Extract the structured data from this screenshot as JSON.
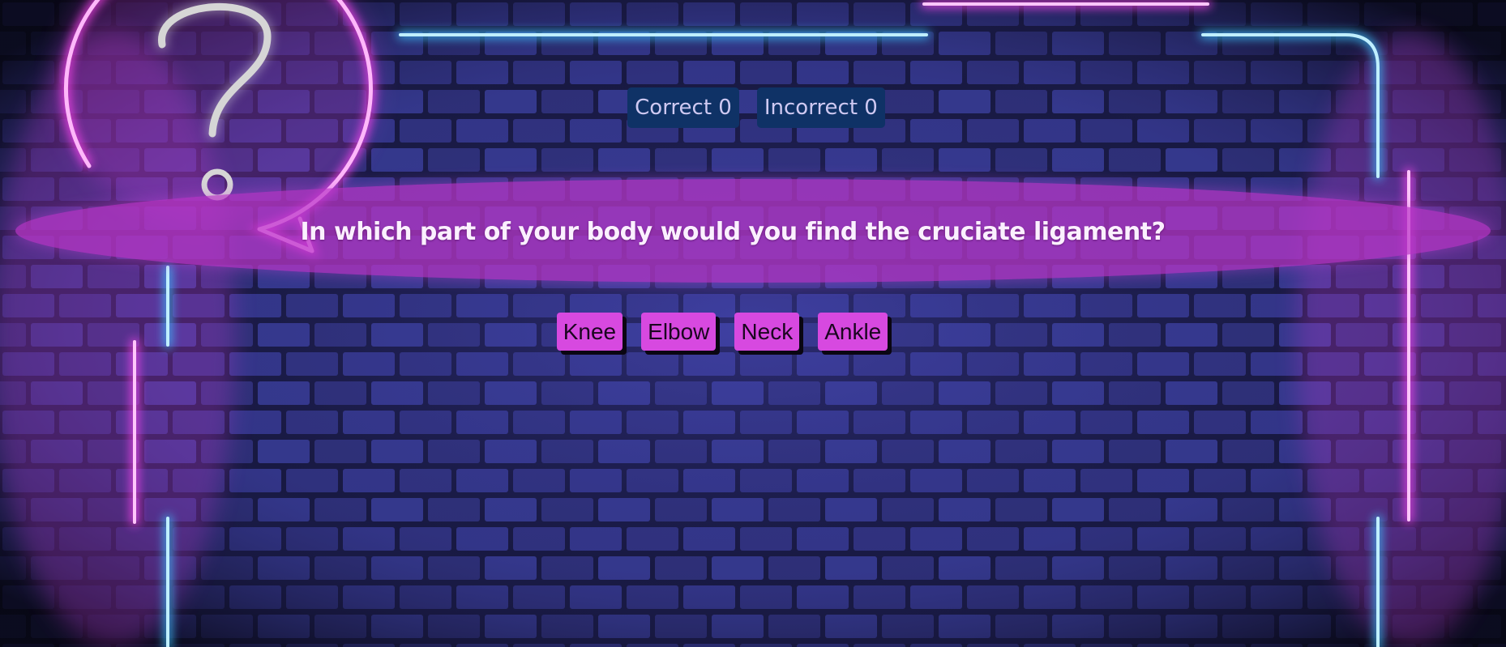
{
  "score": {
    "correct_label": "Correct 0",
    "incorrect_label": "Incorrect 0"
  },
  "question": {
    "text": "In which part of your body would you find the cruciate ligament?"
  },
  "answers": [
    {
      "label": "Knee"
    },
    {
      "label": "Elbow"
    },
    {
      "label": "Neck"
    },
    {
      "label": "Ankle"
    }
  ],
  "colors": {
    "brick_background": "#2a2a6e",
    "neon_pink": "#ff44f0",
    "neon_blue": "#3cc2ff",
    "score_badge": "#0f3266",
    "answer_button": "#d749e0",
    "question_banner": "#ba36c8"
  },
  "icons": {
    "decor": "question-mark-speech-bubble-icon"
  }
}
